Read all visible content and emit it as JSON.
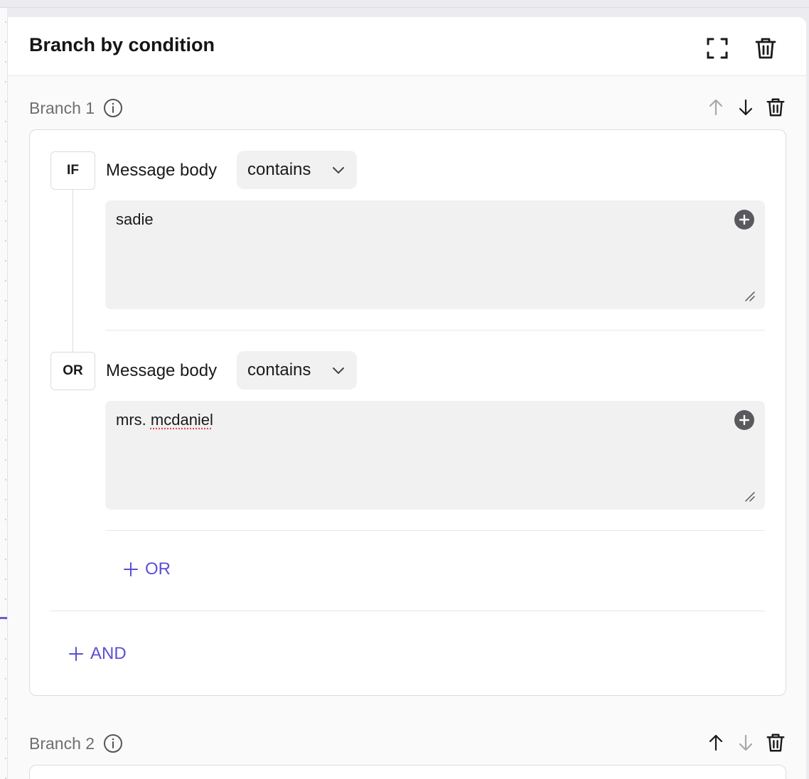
{
  "panel": {
    "title": "Branch by condition"
  },
  "branches": [
    {
      "title": "Branch 1",
      "conditions": [
        {
          "operator": "IF",
          "field": "Message body",
          "comparator": "contains",
          "value": "sadie"
        },
        {
          "operator": "OR",
          "field": "Message body",
          "comparator": "contains",
          "value": "mrs. mcdaniel"
        }
      ],
      "add_or_label": "OR",
      "add_and_label": "AND"
    },
    {
      "title": "Branch 2"
    }
  ],
  "colors": {
    "accent": "#5b4fd4",
    "muted_icon": "#a8a8ac"
  }
}
